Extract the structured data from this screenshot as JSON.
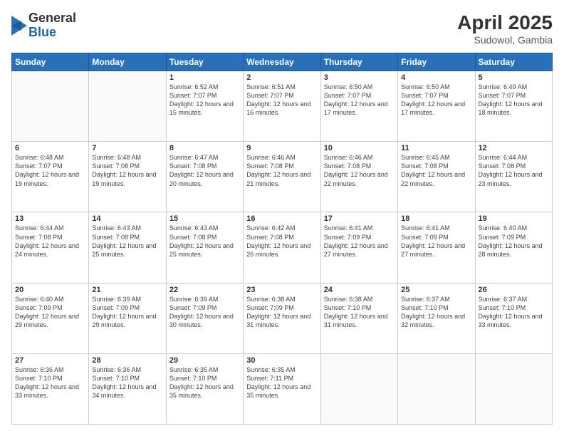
{
  "logo": {
    "general": "General",
    "blue": "Blue"
  },
  "title": "April 2025",
  "subtitle": "Sudowol, Gambia",
  "days_of_week": [
    "Sunday",
    "Monday",
    "Tuesday",
    "Wednesday",
    "Thursday",
    "Friday",
    "Saturday"
  ],
  "weeks": [
    [
      {
        "day": "",
        "info": ""
      },
      {
        "day": "",
        "info": ""
      },
      {
        "day": "1",
        "info": "Sunrise: 6:52 AM\nSunset: 7:07 PM\nDaylight: 12 hours and 15 minutes."
      },
      {
        "day": "2",
        "info": "Sunrise: 6:51 AM\nSunset: 7:07 PM\nDaylight: 12 hours and 16 minutes."
      },
      {
        "day": "3",
        "info": "Sunrise: 6:50 AM\nSunset: 7:07 PM\nDaylight: 12 hours and 17 minutes."
      },
      {
        "day": "4",
        "info": "Sunrise: 6:50 AM\nSunset: 7:07 PM\nDaylight: 12 hours and 17 minutes."
      },
      {
        "day": "5",
        "info": "Sunrise: 6:49 AM\nSunset: 7:07 PM\nDaylight: 12 hours and 18 minutes."
      }
    ],
    [
      {
        "day": "6",
        "info": "Sunrise: 6:48 AM\nSunset: 7:07 PM\nDaylight: 12 hours and 19 minutes."
      },
      {
        "day": "7",
        "info": "Sunrise: 6:48 AM\nSunset: 7:08 PM\nDaylight: 12 hours and 19 minutes."
      },
      {
        "day": "8",
        "info": "Sunrise: 6:47 AM\nSunset: 7:08 PM\nDaylight: 12 hours and 20 minutes."
      },
      {
        "day": "9",
        "info": "Sunrise: 6:46 AM\nSunset: 7:08 PM\nDaylight: 12 hours and 21 minutes."
      },
      {
        "day": "10",
        "info": "Sunrise: 6:46 AM\nSunset: 7:08 PM\nDaylight: 12 hours and 22 minutes."
      },
      {
        "day": "11",
        "info": "Sunrise: 6:45 AM\nSunset: 7:08 PM\nDaylight: 12 hours and 22 minutes."
      },
      {
        "day": "12",
        "info": "Sunrise: 6:44 AM\nSunset: 7:08 PM\nDaylight: 12 hours and 23 minutes."
      }
    ],
    [
      {
        "day": "13",
        "info": "Sunrise: 6:44 AM\nSunset: 7:08 PM\nDaylight: 12 hours and 24 minutes."
      },
      {
        "day": "14",
        "info": "Sunrise: 6:43 AM\nSunset: 7:08 PM\nDaylight: 12 hours and 25 minutes."
      },
      {
        "day": "15",
        "info": "Sunrise: 6:43 AM\nSunset: 7:08 PM\nDaylight: 12 hours and 25 minutes."
      },
      {
        "day": "16",
        "info": "Sunrise: 6:42 AM\nSunset: 7:08 PM\nDaylight: 12 hours and 26 minutes."
      },
      {
        "day": "17",
        "info": "Sunrise: 6:41 AM\nSunset: 7:09 PM\nDaylight: 12 hours and 27 minutes."
      },
      {
        "day": "18",
        "info": "Sunrise: 6:41 AM\nSunset: 7:09 PM\nDaylight: 12 hours and 27 minutes."
      },
      {
        "day": "19",
        "info": "Sunrise: 6:40 AM\nSunset: 7:09 PM\nDaylight: 12 hours and 28 minutes."
      }
    ],
    [
      {
        "day": "20",
        "info": "Sunrise: 6:40 AM\nSunset: 7:09 PM\nDaylight: 12 hours and 29 minutes."
      },
      {
        "day": "21",
        "info": "Sunrise: 6:39 AM\nSunset: 7:09 PM\nDaylight: 12 hours and 29 minutes."
      },
      {
        "day": "22",
        "info": "Sunrise: 6:39 AM\nSunset: 7:09 PM\nDaylight: 12 hours and 30 minutes."
      },
      {
        "day": "23",
        "info": "Sunrise: 6:38 AM\nSunset: 7:09 PM\nDaylight: 12 hours and 31 minutes."
      },
      {
        "day": "24",
        "info": "Sunrise: 6:38 AM\nSunset: 7:10 PM\nDaylight: 12 hours and 31 minutes."
      },
      {
        "day": "25",
        "info": "Sunrise: 6:37 AM\nSunset: 7:10 PM\nDaylight: 12 hours and 32 minutes."
      },
      {
        "day": "26",
        "info": "Sunrise: 6:37 AM\nSunset: 7:10 PM\nDaylight: 12 hours and 33 minutes."
      }
    ],
    [
      {
        "day": "27",
        "info": "Sunrise: 6:36 AM\nSunset: 7:10 PM\nDaylight: 12 hours and 33 minutes."
      },
      {
        "day": "28",
        "info": "Sunrise: 6:36 AM\nSunset: 7:10 PM\nDaylight: 12 hours and 34 minutes."
      },
      {
        "day": "29",
        "info": "Sunrise: 6:35 AM\nSunset: 7:10 PM\nDaylight: 12 hours and 35 minutes."
      },
      {
        "day": "30",
        "info": "Sunrise: 6:35 AM\nSunset: 7:11 PM\nDaylight: 12 hours and 35 minutes."
      },
      {
        "day": "",
        "info": ""
      },
      {
        "day": "",
        "info": ""
      },
      {
        "day": "",
        "info": ""
      }
    ]
  ]
}
